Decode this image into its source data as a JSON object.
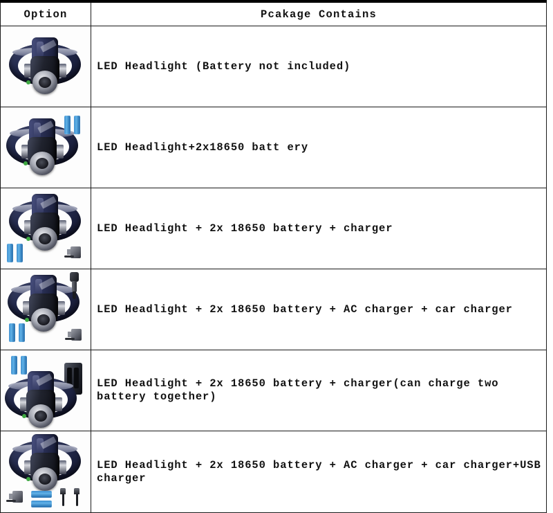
{
  "table": {
    "headers": {
      "option": "Option",
      "contains": "Pcakage Contains"
    },
    "rows": [
      {
        "option_image_alt": "led-headlight-only",
        "contains": "LED Headlight (Battery not included)"
      },
      {
        "option_image_alt": "led-headlight-with-two-batteries",
        "contains": "LED Headlight+2x18650 batt ery"
      },
      {
        "option_image_alt": "led-headlight-with-batteries-and-charger",
        "contains": "LED Headlight + 2x 18650 battery + charger"
      },
      {
        "option_image_alt": "led-headlight-with-batteries-ac-and-car-charger",
        "contains": "LED Headlight + 2x 18650 battery + AC charger + car charger"
      },
      {
        "option_image_alt": "led-headlight-with-batteries-and-dual-bay-charger",
        "contains": "LED Headlight + 2x 18650 battery + charger(can charge two battery together)"
      },
      {
        "option_image_alt": "led-headlight-with-batteries-ac-car-and-usb-charger",
        "contains": "LED Headlight + 2x 18650 battery + AC charger + car charger+USB charger"
      }
    ]
  },
  "colors": {
    "border": "#1a1a1a",
    "top_border": "#000000",
    "text": "#111111",
    "battery_blue": "#2f86cb",
    "background": "#ffffff"
  }
}
